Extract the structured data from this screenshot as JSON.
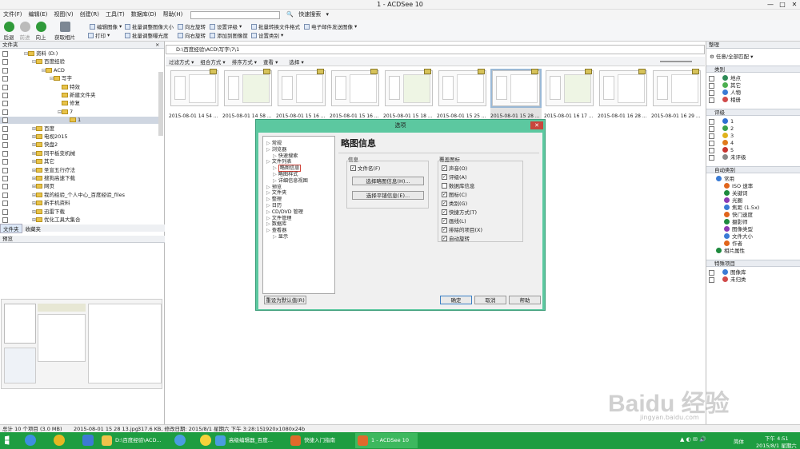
{
  "window": {
    "title": "1 - ACDSee 10",
    "controls": [
      "—",
      "□",
      "✕"
    ]
  },
  "menu": {
    "items": [
      "文件(F)",
      "编辑(E)",
      "视图(V)",
      "创建(R)",
      "工具(T)",
      "数据库(D)",
      "帮助(H)"
    ],
    "quick_search": "快速搜索"
  },
  "toolbar": {
    "back": "后退",
    "forward": "前进",
    "up": "向上",
    "get_photos": "获取相片",
    "print": "打印",
    "edit_image": "编辑图像",
    "batch_resize": "批量调整图像大小",
    "rotate_left": "向左旋转",
    "set_rating": "设置评级",
    "batch_convert": "批量转换文件格式",
    "email": "电子邮件发送图像",
    "batch_exposure": "批量调整曝光度",
    "rotate_right": "向右旋转",
    "add_to_basket": "添加到图像筐",
    "set_category": "设置类别"
  },
  "left": {
    "folders_title": "文件夹",
    "tree": [
      "资料 (D:)",
      "百度经验",
      "ACD",
      "写字",
      "特效",
      "新建文件夹",
      "修复",
      "7",
      "1",
      "百度",
      "电视2015",
      "快盘2",
      "同平板变机械",
      "其它",
      "圣宣五行疗法",
      "搜狗高速下载",
      "网页",
      "我的经验_个人中心_百度经验_files",
      "新手机资料",
      "迅雷下载",
      "优化工具大集合"
    ],
    "tabs": [
      "文件夹",
      "收藏夹"
    ],
    "preview_title": "预览"
  },
  "center": {
    "path": "D:\\百度经验\\ACD\\写字\\7\\1",
    "subtool": [
      "过滤方式",
      "组合方式",
      "排序方式",
      "查看",
      "选择"
    ],
    "thumbs": [
      "2015-08-01 14 54 ...",
      "2015-08-01 14 58 ...",
      "2015-08-01 15 16 ...",
      "2015-08-01 15 16 ...",
      "2015-08-01 15 18 ...",
      "2015-08-01 15 25 ...",
      "2015-08-01 15 28 ...",
      "2015-08-01 16 17 ...",
      "2015-08-01 16 28 ...",
      "2015-08-01 16 29 ..."
    ]
  },
  "right": {
    "title": "整理",
    "match_label": "任意/全部匹配",
    "categories_title": "类别",
    "categories": [
      "地点",
      "其它",
      "人物",
      "相册"
    ],
    "ratings_title": "评级",
    "ratings": [
      "1",
      "2",
      "3",
      "4",
      "5",
      "未评级"
    ],
    "auto_title": "自动类别",
    "auto": [
      "常用",
      "ISO 速率",
      "关键词",
      "光圈",
      "焦距 (1.5x)",
      "快门速度",
      "摄影师",
      "图像类型",
      "文件大小",
      "作者",
      "相片属性"
    ],
    "auto_colors": [
      "#3a7bd5",
      "#e1651c",
      "#1e8a3e",
      "#8c3ab5"
    ],
    "special_title": "特殊项目",
    "special": [
      "图像库",
      "未归类"
    ]
  },
  "dialog": {
    "title": "选项",
    "heading": "略图信息",
    "tree": [
      "常规",
      "浏览器",
      "快速搜索",
      "文件列表",
      "略图信息",
      "略图样式",
      "详细信息视图",
      "预览",
      "文件夹",
      "整理",
      "日历",
      "CD/DVD 管理",
      "文件管理",
      "数据库",
      "查看器",
      "显示"
    ],
    "info_group": "信息",
    "filename_cb": "文件名(F)",
    "btn_thumb_info": "选择略图信息(H)...",
    "btn_tile_info": "选择平铺信息(E)...",
    "overlay_group": "覆盖图标",
    "overlays": [
      "声音(O)",
      "评级(A)",
      "数据库信息",
      "图标(C)",
      "类别(G)",
      "快捷方式(T)",
      "画线(L)",
      "排除的项目(X)",
      "自动旋转"
    ],
    "overlay_checked": [
      true,
      true,
      false,
      true,
      true,
      true,
      true,
      true,
      true
    ],
    "reset": "重设为默认值(R)",
    "ok": "确定",
    "cancel": "取消",
    "help": "帮助"
  },
  "status": {
    "total": "总计 10 个项目 (3.0 MB)",
    "file": "2015-08-01 15 28 13.jpg",
    "size": "317.6 KB, 修改日期: 2015/8/1 星期六 下午 3:28:15",
    "dims": "1920x1080x24b"
  },
  "taskbar": {
    "items": [
      "D:\\百度经验\\ACD...",
      "高级编辑器_百度...",
      "快捷入门指南",
      "1 - ACDSee 10"
    ],
    "lang": "简体",
    "time": "下午 4:51",
    "date": "2015/8/1 星期六"
  },
  "watermark": {
    "text": "Baidu 经验",
    "sub": "jingyan.baidu.com"
  }
}
